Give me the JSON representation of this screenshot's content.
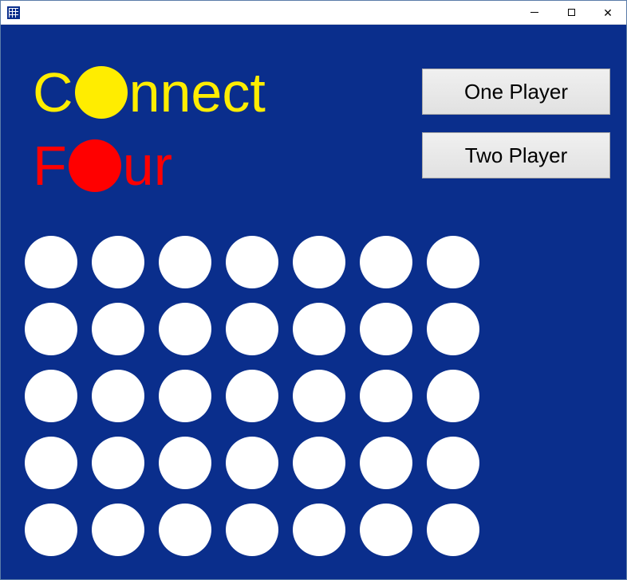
{
  "window": {
    "title": ""
  },
  "titles": {
    "line1_before": "C",
    "line1_after": "nnect",
    "line2_before": "F",
    "line2_after": "ur"
  },
  "buttons": {
    "one_player": "One Player",
    "two_player": "Two Player"
  },
  "board": {
    "rows": 5,
    "cols": 7,
    "cells": [
      [
        "empty",
        "empty",
        "empty",
        "empty",
        "empty",
        "empty",
        "empty"
      ],
      [
        "empty",
        "empty",
        "empty",
        "empty",
        "empty",
        "empty",
        "empty"
      ],
      [
        "empty",
        "empty",
        "empty",
        "empty",
        "empty",
        "empty",
        "empty"
      ],
      [
        "empty",
        "empty",
        "empty",
        "empty",
        "empty",
        "empty",
        "empty"
      ],
      [
        "empty",
        "empty",
        "empty",
        "empty",
        "empty",
        "empty",
        "empty"
      ]
    ]
  },
  "colors": {
    "board_bg": "#0a2e8c",
    "yellow": "#ffed00",
    "red": "#ff0000",
    "empty": "#ffffff"
  }
}
